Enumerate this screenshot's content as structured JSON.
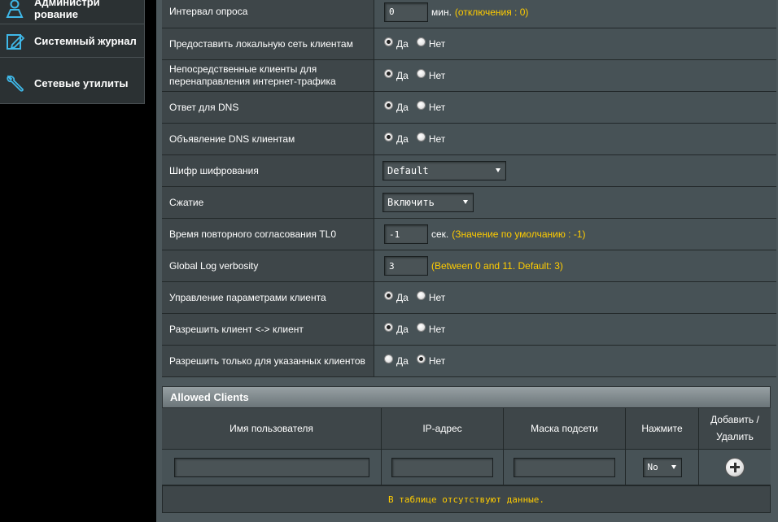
{
  "sidebar": {
    "items": [
      {
        "label": "Администри рование",
        "icon": "admin-person-icon"
      },
      {
        "label": "Системный журнал",
        "icon": "system-log-icon"
      },
      {
        "label": "Сетевые утилиты",
        "icon": "network-tools-icon"
      }
    ]
  },
  "settings": {
    "poll_interval": {
      "label": "Интервал опроса",
      "value": "0",
      "unit": "мин.",
      "hint": "(отключения : 0)"
    },
    "provide_lan": {
      "label": "Предоставить локальную сеть клиентам",
      "yes": "Да",
      "no": "Нет",
      "selected": "yes"
    },
    "direct_clients": {
      "label": "Непосредственные клиенты для перенаправления интернет-трафика",
      "yes": "Да",
      "no": "Нет",
      "selected": "yes"
    },
    "dns_response": {
      "label": "Ответ для DNS",
      "yes": "Да",
      "no": "Нет",
      "selected": "yes"
    },
    "dns_advertise": {
      "label": "Объявление DNS клиентам",
      "yes": "Да",
      "no": "Нет",
      "selected": "yes"
    },
    "cipher": {
      "label": "Шифр шифрования",
      "value": "Default"
    },
    "compression": {
      "label": "Сжатие",
      "value": "Включить"
    },
    "tls_reneg": {
      "label": "Время повторного согласования TL0",
      "value": "-1",
      "unit": "сек.",
      "hint": "(Значение по умолчанию : -1)"
    },
    "log_verbosity": {
      "label": "Global Log verbosity",
      "value": "3",
      "hint": "(Between 0 and 11. Default: 3)"
    },
    "client_params": {
      "label": "Управление параметрами клиента",
      "yes": "Да",
      "no": "Нет",
      "selected": "yes"
    },
    "client_to_client": {
      "label": "Разрешить клиент <-> клиент",
      "yes": "Да",
      "no": "Нет",
      "selected": "yes"
    },
    "only_specified": {
      "label": "Разрешить только для указанных клиентов",
      "yes": "Да",
      "no": "Нет",
      "selected": "no"
    }
  },
  "allowed_clients": {
    "title": "Allowed Clients",
    "columns": [
      "Имя пользователя",
      "IP-адрес",
      "Маска подсети",
      "Нажмите",
      "Добавить / Удалить"
    ],
    "push_value": "No",
    "empty_message": "В таблице отсутствуют данные."
  },
  "colors": {
    "hint": "#ffcc00",
    "label_bg": "#3e4649",
    "value_bg": "#475256"
  }
}
